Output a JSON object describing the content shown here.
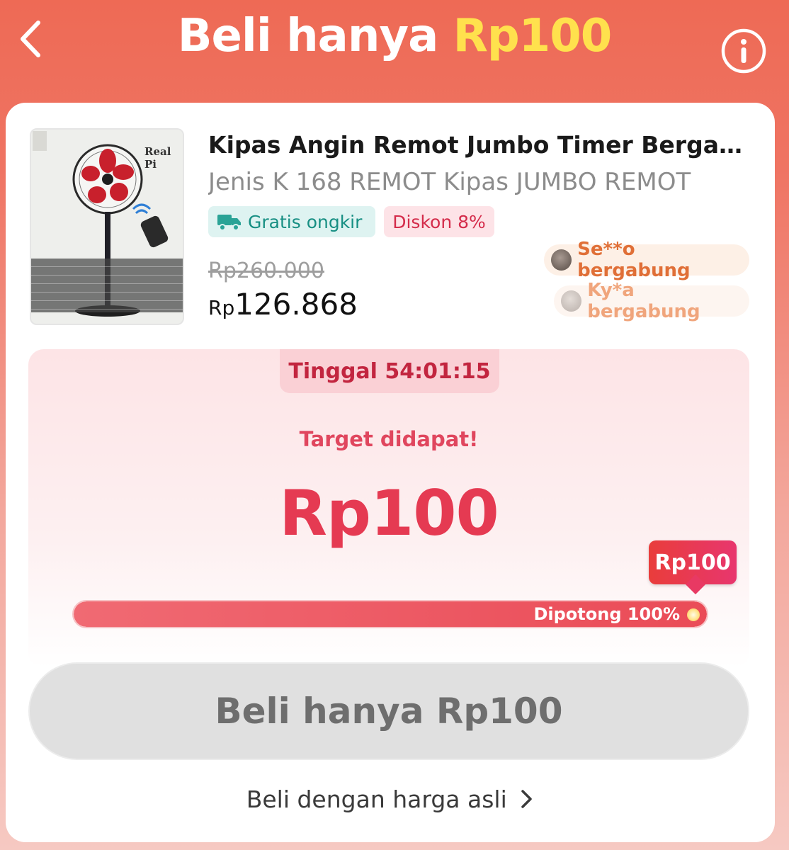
{
  "header": {
    "title_prefix": "Beli hanya ",
    "title_price": "Rp100",
    "back_icon": "chevron-left-icon",
    "info_icon": "info-icon"
  },
  "product": {
    "image_watermark": "Real Pi",
    "title": "Kipas Angin Remot Jumbo Timer Bergaransi",
    "subtitle": "Jenis K 168 REMOT Kipas JUMBO REMOT",
    "badges": {
      "shipping": "Gratis ongkir",
      "discount": "Diskon 8%"
    },
    "original_price": "Rp260.000",
    "price_currency": "Rp",
    "price_amount": "126.868"
  },
  "participants": [
    {
      "label": "Se**o bergabung"
    },
    {
      "label": "Ky*a bergabung"
    }
  ],
  "deal": {
    "timer": "Tinggal 54:01:15",
    "status": "Target didapat!",
    "price": "Rp100",
    "bubble_price": "Rp100",
    "progress_label": "Dipotong 100%",
    "progress_fraction": 1.0
  },
  "actions": {
    "buy_button": "Beli hanya Rp100",
    "original_price_link": "Beli dengan harga asli"
  },
  "colors": {
    "header_bg": "#ee6a55",
    "accent_yellow": "#ffe14d",
    "deal_red": "#e53a52",
    "shipping_green": "#178f83"
  }
}
